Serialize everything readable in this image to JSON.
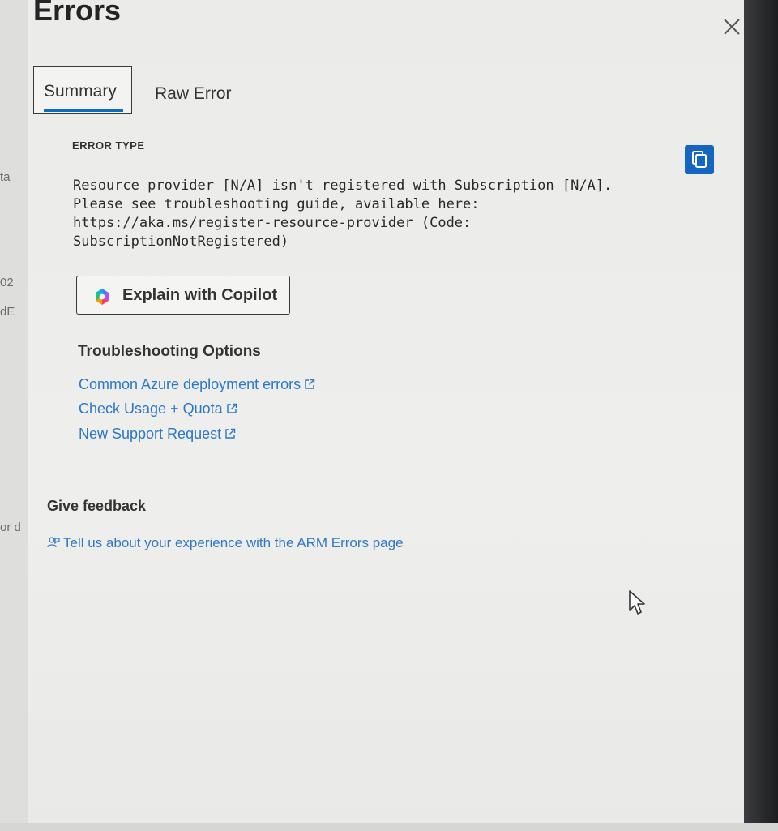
{
  "left_fragments": [
    "ta",
    "02",
    "dE",
    "or d"
  ],
  "dialog": {
    "title": "Errors",
    "close_label": "×"
  },
  "tabs": [
    {
      "label": "Summary",
      "active": true
    },
    {
      "label": "Raw Error",
      "active": false
    }
  ],
  "error": {
    "type_label": "ERROR TYPE",
    "message_lines": [
      "Resource provider [N/A] isn't registered with Subscription [N/A].",
      "Please see troubleshooting guide, available here:",
      "https://aka.ms/register-resource-provider (Code:",
      "SubscriptionNotRegistered)"
    ]
  },
  "copilot": {
    "label": "Explain with Copilot"
  },
  "troubleshooting": {
    "heading": "Troubleshooting Options",
    "links": [
      {
        "label": "Common Azure deployment errors"
      },
      {
        "label": "Check Usage + Quota"
      },
      {
        "label": "New Support Request"
      }
    ]
  },
  "feedback": {
    "heading": "Give feedback",
    "link_label": "Tell us about your experience with the ARM Errors page"
  },
  "colors": {
    "accent": "#0f6cbd",
    "link": "#2c78c7"
  }
}
